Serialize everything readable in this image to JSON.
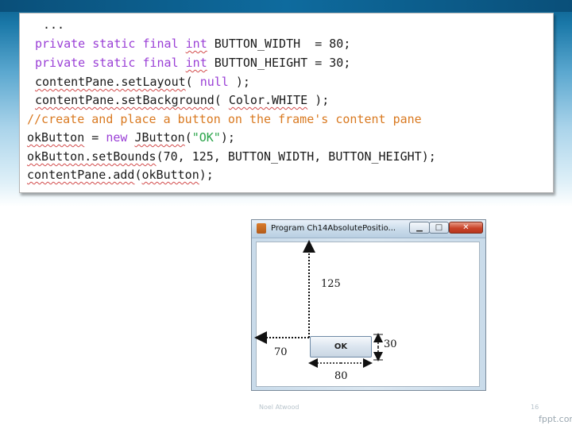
{
  "code": {
    "line1": "...",
    "line2": {
      "kw": "private static final",
      "type": "int",
      "rest": " BUTTON_WIDTH  = 80;"
    },
    "line3": {
      "kw": "private static final",
      "type": "int",
      "rest": " BUTTON_HEIGHT = 30;"
    },
    "line4": {
      "obj": "contentPane.setLayout",
      "open": "( ",
      "kw": "null",
      "close": " );"
    },
    "line5": {
      "obj": "contentPane.setBackground",
      "open": "( ",
      "arg": "Color.WHITE",
      "close": " );"
    },
    "line6": "//create and place a button on the frame's content pane",
    "line7": {
      "var": "okButton",
      "eq": " = ",
      "kw": "new",
      "sp": " ",
      "cls": "JButton",
      "open": "(",
      "str": "\"OK\"",
      "close": ");"
    },
    "line8": {
      "obj": "okButton.setBounds",
      "rest": "(70, 125, BUTTON_WIDTH, BUTTON_HEIGHT);"
    },
    "line9": {
      "obj": "contentPane.add",
      "open": "(",
      "arg": "okButton",
      "close": ");"
    }
  },
  "window": {
    "title": "Program Ch14AbsolutePositio...",
    "minimize_glyph": "▁",
    "maximize_glyph": "□",
    "close_glyph": "✕",
    "button_label": "OK"
  },
  "dimensions": {
    "top": "125",
    "left": "70",
    "height": "30",
    "width": "80"
  },
  "footer": {
    "author": "Noel Atwood",
    "page": "16",
    "brand": "fppt.com"
  },
  "colors": {
    "keyword": "#9a3fd6",
    "comment": "#d97920",
    "string": "#2aa44a",
    "slide_top": "#0b5d8c"
  }
}
